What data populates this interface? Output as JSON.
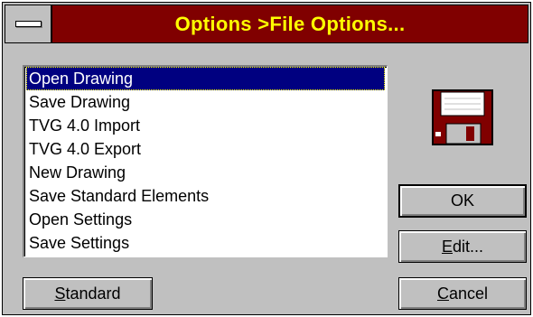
{
  "window": {
    "title": "Options >File Options..."
  },
  "list": {
    "items": [
      "Open Drawing",
      "Save Drawing",
      "TVG 4.0 Import",
      "TVG 4.0 Export",
      "New Drawing",
      "Save Standard Elements",
      "Open Settings",
      "Save Settings"
    ],
    "selected_index": 0
  },
  "buttons": {
    "ok": {
      "label": "OK",
      "mnemonic": ""
    },
    "edit": {
      "mnemonic": "E",
      "rest": "dit..."
    },
    "cancel": {
      "mnemonic": "C",
      "rest": "ancel"
    },
    "standard": {
      "mnemonic": "S",
      "rest": "tandard"
    }
  },
  "icons": {
    "system_menu": "system-menu-icon",
    "disk": "floppy-disk-icon",
    "disk_color": "#800000"
  },
  "colors": {
    "title_bg": "#800000",
    "title_text": "#ffff00",
    "selection_bg": "#000080",
    "face": "#c0c0c0"
  }
}
